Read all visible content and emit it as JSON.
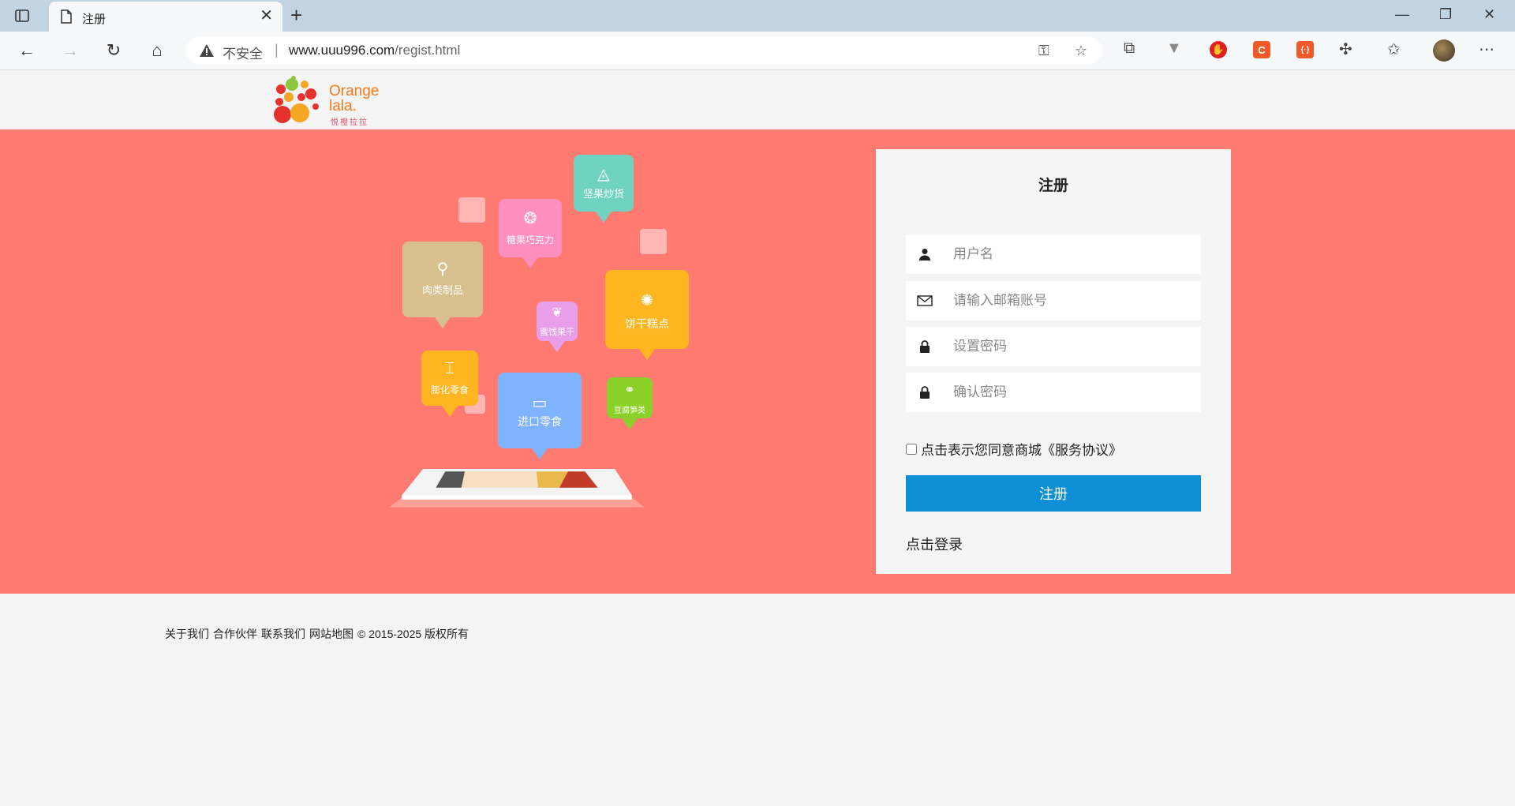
{
  "browser": {
    "tab_title": "注册",
    "security_label": "不安全",
    "url_domain": "www.uuu996.com",
    "url_path": "/regist.html"
  },
  "logo": {
    "line1": "Orange",
    "line2": "lala.",
    "line3": "悦橙拉拉"
  },
  "illustration": {
    "categories": [
      "坚果炒货",
      "糖果巧克力",
      "肉类制品",
      "饼干糕点",
      "蜜饯果干",
      "膨化零食",
      "进口零食",
      "豆腐笋类"
    ]
  },
  "form": {
    "title": "注册",
    "username_placeholder": "用户名",
    "email_placeholder": "请输入邮箱账号",
    "password_placeholder": "设置密码",
    "confirm_placeholder": "确认密码",
    "agree_text": "点击表示您同意商城《服务协议》",
    "submit_label": "注册",
    "login_link": "点击登录"
  },
  "footer": {
    "links": [
      "关于我们",
      "合作伙伴",
      "联系我们",
      "网站地图"
    ],
    "copyright": "© 2015-2025 版权所有"
  },
  "colors": {
    "banner": "#ff7a70",
    "button": "#0e8fd6",
    "brand": "#f07a1a"
  }
}
